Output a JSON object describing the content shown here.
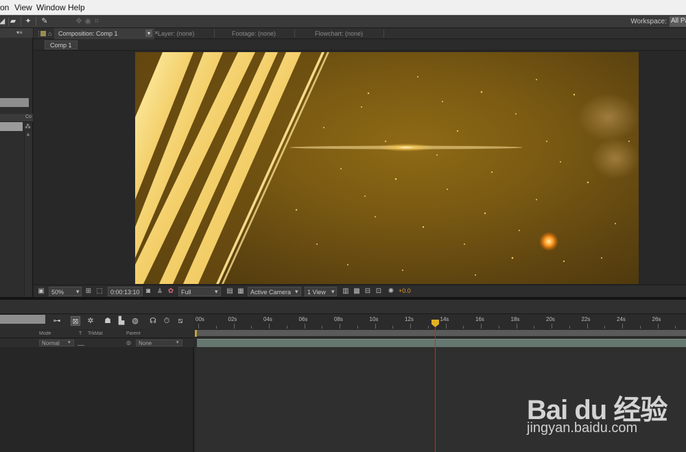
{
  "menubar": {
    "items": [
      "on",
      "View",
      "Window",
      "Help"
    ]
  },
  "toolbar": {
    "workspace_label": "Workspace:",
    "workspace_value": "All Pa"
  },
  "comp_panel": {
    "tabs": {
      "composition": "Composition: Comp 1",
      "layer": "Layer: (none)",
      "footage": "Footage: (none)",
      "flowchart": "Flowchart: (none)"
    },
    "breadcrumb": "Comp 1",
    "left_col_label": "Co"
  },
  "viewer_toolbar": {
    "zoom": "50%",
    "timecode": "0:00:13:10",
    "resolution": "Full",
    "camera": "Active Camera",
    "views": "1 View",
    "exposure": "+0.0"
  },
  "timeline": {
    "ruler_labels": [
      "00s",
      "02s",
      "04s",
      "06s",
      "08s",
      "10s",
      "12s",
      "14s",
      "16s",
      "18s",
      "20s",
      "22s",
      "24s",
      "26s"
    ],
    "columns": {
      "mode": "Mode",
      "t": "T",
      "trkmat": "TrkMat",
      "parent": "Parent"
    },
    "layer": {
      "mode": "Normal",
      "parent": "None"
    },
    "current_time_seconds": 13.4
  },
  "watermark": {
    "main": "Bai du 经验",
    "url": "jingyan.baidu.com"
  },
  "colors": {
    "accent_orange": "#e39a2a",
    "cti_red": "#d2261f",
    "layer_bar": "#65776f"
  }
}
